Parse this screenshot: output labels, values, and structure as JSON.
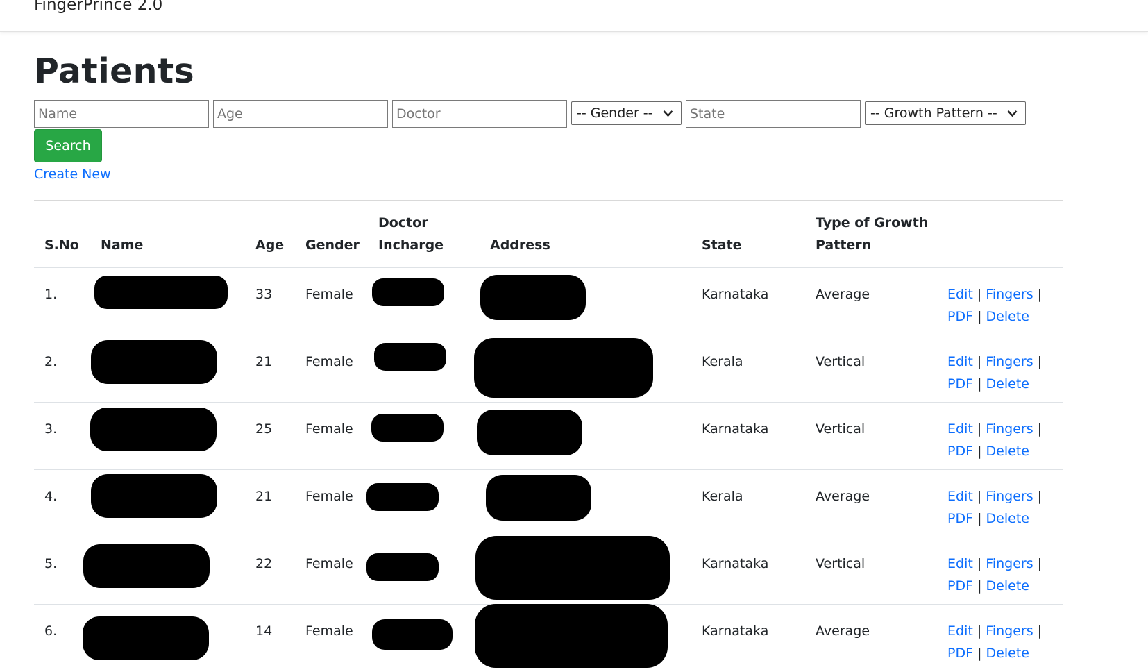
{
  "app": {
    "title": "FingerPrince 2.0"
  },
  "page": {
    "title": "Patients"
  },
  "filters": {
    "name_placeholder": "Name",
    "age_placeholder": "Age",
    "doctor_placeholder": "Doctor",
    "gender_selected": "-- Gender --",
    "state_placeholder": "State",
    "growth_selected": "-- Growth Pattern --",
    "search_label": "Search",
    "create_new_label": "Create New"
  },
  "table": {
    "headers": {
      "sno": "S.No",
      "name": "Name",
      "age": "Age",
      "gender": "Gender",
      "doctor_line1": "Doctor",
      "doctor_line2": "Incharge",
      "address": "Address",
      "state": "State",
      "growth_line1": "Type of Growth",
      "growth_line2": "Pattern"
    },
    "action_labels": {
      "edit": "Edit",
      "fingers": "Fingers",
      "pdf": "PDF",
      "delete": "Delete",
      "separator": "|"
    },
    "rows": [
      {
        "sno": "1.",
        "age": "33",
        "gender": "Female",
        "state": "Karnataka",
        "growth": "Average"
      },
      {
        "sno": "2.",
        "age": "21",
        "gender": "Female",
        "state": "Kerala",
        "growth": "Vertical"
      },
      {
        "sno": "3.",
        "age": "25",
        "gender": "Female",
        "state": "Karnataka",
        "growth": "Vertical"
      },
      {
        "sno": "4.",
        "age": "21",
        "gender": "Female",
        "state": "Kerala",
        "growth": "Average"
      },
      {
        "sno": "5.",
        "age": "22",
        "gender": "Female",
        "state": "Karnataka",
        "growth": "Vertical"
      },
      {
        "sno": "6.",
        "age": "14",
        "gender": "Female",
        "state": "Karnataka",
        "growth": "Average"
      }
    ]
  },
  "colors": {
    "primary_link": "#0d6efd",
    "success_button": "#28a745",
    "redaction": "#000000"
  },
  "icons": {
    "select_arrow": "chevron-down-icon"
  }
}
